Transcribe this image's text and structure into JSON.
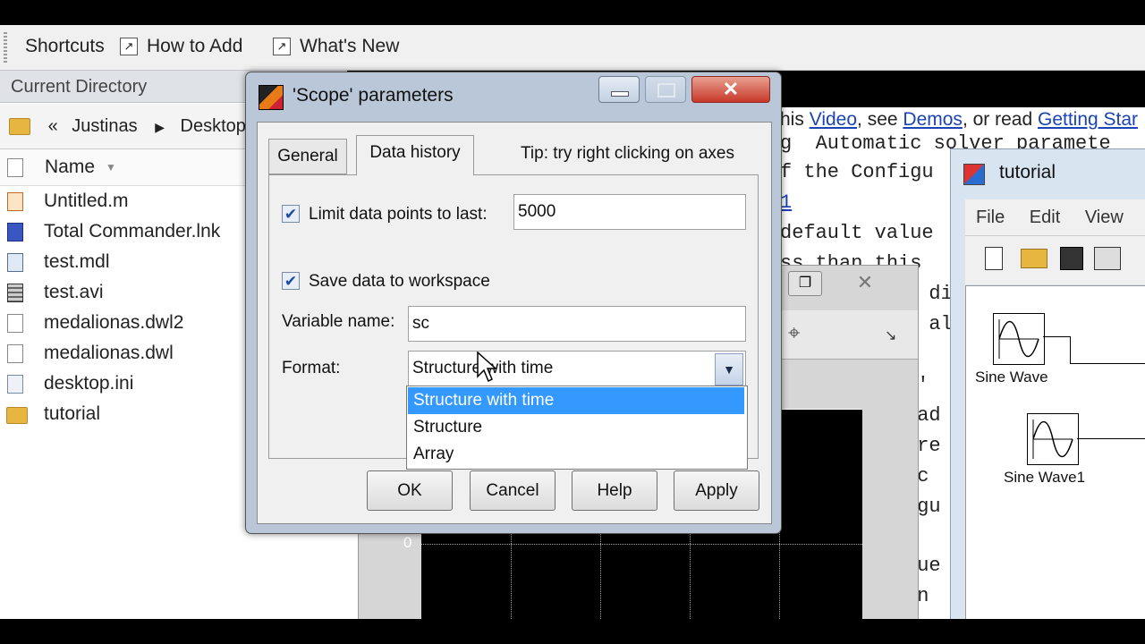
{
  "shortcuts": {
    "label": "Shortcuts",
    "how_to_add": "How to Add",
    "whats_new": "What's New"
  },
  "current_directory": {
    "title": "Current Directory",
    "path": [
      "«",
      "Justinas",
      "Desktop"
    ],
    "name_header": "Name",
    "files": [
      "Untitled.m",
      "Total Commander.lnk",
      "test.mdl",
      "test.avi",
      "medalionas.dwl2",
      "medalionas.dwl",
      "desktop.ini",
      "tutorial"
    ]
  },
  "help_text": {
    "line1_pre": "his ",
    "video": "Video",
    "line1_mid": ", see ",
    "demos": "Demos",
    "line1_post": ", or read ",
    "getting_started": "Getting Star",
    "lines": [
      "g  Automatic solver paramete",
      "f the Configu",
      "1",
      "default value",
      "ss than this",
      "  di",
      "  alo",
      "l'",
      "ead",
      "cre",
      "ic",
      "igu",
      "lue",
      "an"
    ]
  },
  "dialog": {
    "title": "'Scope' parameters",
    "tabs": {
      "general": "General",
      "data_history": "Data history"
    },
    "tip": "Tip: try right clicking on axes",
    "limit_label": "Limit data points to last:",
    "limit_value": "5000",
    "limit_checked": true,
    "save_label": "Save data to workspace",
    "save_checked": true,
    "varname_label": "Variable name:",
    "varname_value": "sc",
    "format_label": "Format:",
    "format_value": "Structure with time",
    "format_options": [
      "Structure with time",
      "Structure",
      "Array"
    ],
    "buttons": {
      "ok": "OK",
      "cancel": "Cancel",
      "help": "Help",
      "apply": "Apply"
    }
  },
  "scope": {
    "axis_zero": "0"
  },
  "tutorial": {
    "title": "tutorial",
    "menu": {
      "file": "File",
      "edit": "Edit",
      "view": "View"
    },
    "blocks": [
      "Sine Wave",
      "Sine Wave1"
    ]
  },
  "colors": {
    "selection": "#3399ff",
    "link": "#1a43b5",
    "dialog_frame": "#b9c7d8"
  }
}
